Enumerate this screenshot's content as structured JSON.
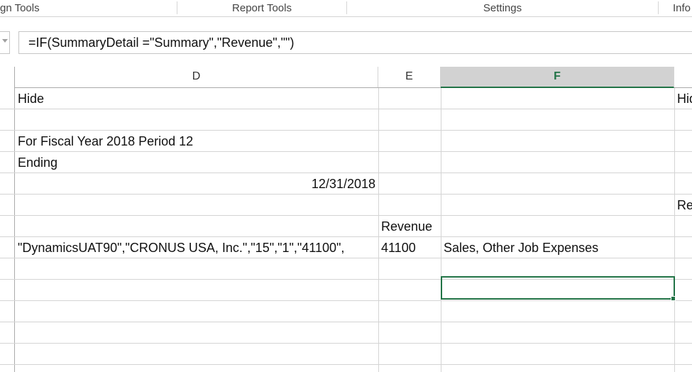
{
  "ribbon": {
    "groups": [
      {
        "label": "gn Tools"
      },
      {
        "label": "Report Tools"
      },
      {
        "label": "Settings"
      },
      {
        "label": "Info"
      }
    ]
  },
  "formula_bar": {
    "formula": "=IF(SummaryDetail =\"Summary\",\"Revenue\",\"\")"
  },
  "columns": {
    "d": "D",
    "e": "E",
    "f": "F",
    "selected": "F"
  },
  "cells": {
    "d_hide": "Hide",
    "g_hide": "Hide",
    "d_fiscal": "For Fiscal Year 2018 Period 12",
    "d_ending": "Ending",
    "d_date": "12/31/2018",
    "g_re": "Re",
    "e_revenue": "Revenue",
    "d_key": "\"DynamicsUAT90\",\"CRONUS USA, Inc.\",\"15\",\"1\",\"41100\",",
    "e_account": "41100",
    "f_name": "Sales, Other Job Expenses"
  },
  "colors": {
    "selection": "#217346",
    "header_selected_bg": "#d2d2d2",
    "gridline": "#d4d4d4"
  }
}
